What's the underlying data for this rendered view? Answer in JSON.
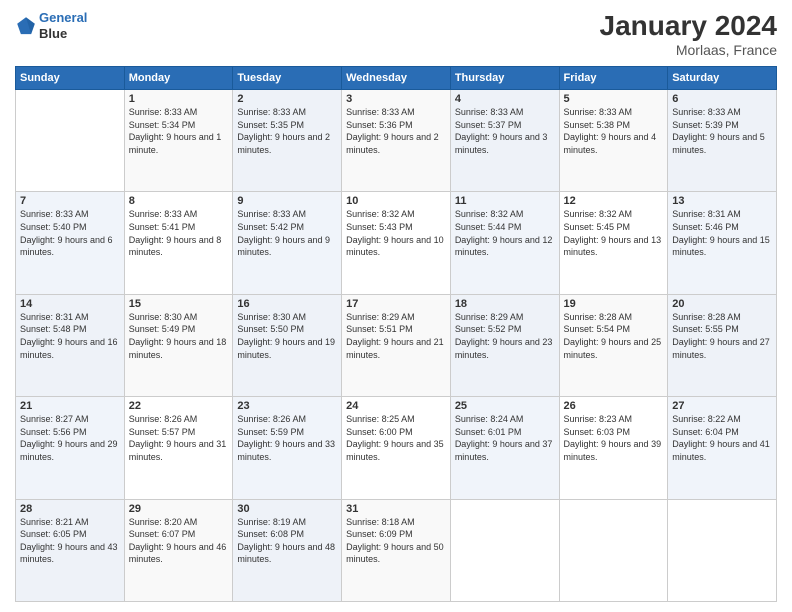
{
  "header": {
    "logo_line1": "General",
    "logo_line2": "Blue",
    "month": "January 2024",
    "location": "Morlaas, France"
  },
  "weekdays": [
    "Sunday",
    "Monday",
    "Tuesday",
    "Wednesday",
    "Thursday",
    "Friday",
    "Saturday"
  ],
  "weeks": [
    [
      {
        "day": "",
        "sunrise": "",
        "sunset": "",
        "daylight": ""
      },
      {
        "day": "1",
        "sunrise": "Sunrise: 8:33 AM",
        "sunset": "Sunset: 5:34 PM",
        "daylight": "Daylight: 9 hours and 1 minute."
      },
      {
        "day": "2",
        "sunrise": "Sunrise: 8:33 AM",
        "sunset": "Sunset: 5:35 PM",
        "daylight": "Daylight: 9 hours and 2 minutes."
      },
      {
        "day": "3",
        "sunrise": "Sunrise: 8:33 AM",
        "sunset": "Sunset: 5:36 PM",
        "daylight": "Daylight: 9 hours and 2 minutes."
      },
      {
        "day": "4",
        "sunrise": "Sunrise: 8:33 AM",
        "sunset": "Sunset: 5:37 PM",
        "daylight": "Daylight: 9 hours and 3 minutes."
      },
      {
        "day": "5",
        "sunrise": "Sunrise: 8:33 AM",
        "sunset": "Sunset: 5:38 PM",
        "daylight": "Daylight: 9 hours and 4 minutes."
      },
      {
        "day": "6",
        "sunrise": "Sunrise: 8:33 AM",
        "sunset": "Sunset: 5:39 PM",
        "daylight": "Daylight: 9 hours and 5 minutes."
      }
    ],
    [
      {
        "day": "7",
        "sunrise": "Sunrise: 8:33 AM",
        "sunset": "Sunset: 5:40 PM",
        "daylight": "Daylight: 9 hours and 6 minutes."
      },
      {
        "day": "8",
        "sunrise": "Sunrise: 8:33 AM",
        "sunset": "Sunset: 5:41 PM",
        "daylight": "Daylight: 9 hours and 8 minutes."
      },
      {
        "day": "9",
        "sunrise": "Sunrise: 8:33 AM",
        "sunset": "Sunset: 5:42 PM",
        "daylight": "Daylight: 9 hours and 9 minutes."
      },
      {
        "day": "10",
        "sunrise": "Sunrise: 8:32 AM",
        "sunset": "Sunset: 5:43 PM",
        "daylight": "Daylight: 9 hours and 10 minutes."
      },
      {
        "day": "11",
        "sunrise": "Sunrise: 8:32 AM",
        "sunset": "Sunset: 5:44 PM",
        "daylight": "Daylight: 9 hours and 12 minutes."
      },
      {
        "day": "12",
        "sunrise": "Sunrise: 8:32 AM",
        "sunset": "Sunset: 5:45 PM",
        "daylight": "Daylight: 9 hours and 13 minutes."
      },
      {
        "day": "13",
        "sunrise": "Sunrise: 8:31 AM",
        "sunset": "Sunset: 5:46 PM",
        "daylight": "Daylight: 9 hours and 15 minutes."
      }
    ],
    [
      {
        "day": "14",
        "sunrise": "Sunrise: 8:31 AM",
        "sunset": "Sunset: 5:48 PM",
        "daylight": "Daylight: 9 hours and 16 minutes."
      },
      {
        "day": "15",
        "sunrise": "Sunrise: 8:30 AM",
        "sunset": "Sunset: 5:49 PM",
        "daylight": "Daylight: 9 hours and 18 minutes."
      },
      {
        "day": "16",
        "sunrise": "Sunrise: 8:30 AM",
        "sunset": "Sunset: 5:50 PM",
        "daylight": "Daylight: 9 hours and 19 minutes."
      },
      {
        "day": "17",
        "sunrise": "Sunrise: 8:29 AM",
        "sunset": "Sunset: 5:51 PM",
        "daylight": "Daylight: 9 hours and 21 minutes."
      },
      {
        "day": "18",
        "sunrise": "Sunrise: 8:29 AM",
        "sunset": "Sunset: 5:52 PM",
        "daylight": "Daylight: 9 hours and 23 minutes."
      },
      {
        "day": "19",
        "sunrise": "Sunrise: 8:28 AM",
        "sunset": "Sunset: 5:54 PM",
        "daylight": "Daylight: 9 hours and 25 minutes."
      },
      {
        "day": "20",
        "sunrise": "Sunrise: 8:28 AM",
        "sunset": "Sunset: 5:55 PM",
        "daylight": "Daylight: 9 hours and 27 minutes."
      }
    ],
    [
      {
        "day": "21",
        "sunrise": "Sunrise: 8:27 AM",
        "sunset": "Sunset: 5:56 PM",
        "daylight": "Daylight: 9 hours and 29 minutes."
      },
      {
        "day": "22",
        "sunrise": "Sunrise: 8:26 AM",
        "sunset": "Sunset: 5:57 PM",
        "daylight": "Daylight: 9 hours and 31 minutes."
      },
      {
        "day": "23",
        "sunrise": "Sunrise: 8:26 AM",
        "sunset": "Sunset: 5:59 PM",
        "daylight": "Daylight: 9 hours and 33 minutes."
      },
      {
        "day": "24",
        "sunrise": "Sunrise: 8:25 AM",
        "sunset": "Sunset: 6:00 PM",
        "daylight": "Daylight: 9 hours and 35 minutes."
      },
      {
        "day": "25",
        "sunrise": "Sunrise: 8:24 AM",
        "sunset": "Sunset: 6:01 PM",
        "daylight": "Daylight: 9 hours and 37 minutes."
      },
      {
        "day": "26",
        "sunrise": "Sunrise: 8:23 AM",
        "sunset": "Sunset: 6:03 PM",
        "daylight": "Daylight: 9 hours and 39 minutes."
      },
      {
        "day": "27",
        "sunrise": "Sunrise: 8:22 AM",
        "sunset": "Sunset: 6:04 PM",
        "daylight": "Daylight: 9 hours and 41 minutes."
      }
    ],
    [
      {
        "day": "28",
        "sunrise": "Sunrise: 8:21 AM",
        "sunset": "Sunset: 6:05 PM",
        "daylight": "Daylight: 9 hours and 43 minutes."
      },
      {
        "day": "29",
        "sunrise": "Sunrise: 8:20 AM",
        "sunset": "Sunset: 6:07 PM",
        "daylight": "Daylight: 9 hours and 46 minutes."
      },
      {
        "day": "30",
        "sunrise": "Sunrise: 8:19 AM",
        "sunset": "Sunset: 6:08 PM",
        "daylight": "Daylight: 9 hours and 48 minutes."
      },
      {
        "day": "31",
        "sunrise": "Sunrise: 8:18 AM",
        "sunset": "Sunset: 6:09 PM",
        "daylight": "Daylight: 9 hours and 50 minutes."
      },
      {
        "day": "",
        "sunrise": "",
        "sunset": "",
        "daylight": ""
      },
      {
        "day": "",
        "sunrise": "",
        "sunset": "",
        "daylight": ""
      },
      {
        "day": "",
        "sunrise": "",
        "sunset": "",
        "daylight": ""
      }
    ]
  ]
}
